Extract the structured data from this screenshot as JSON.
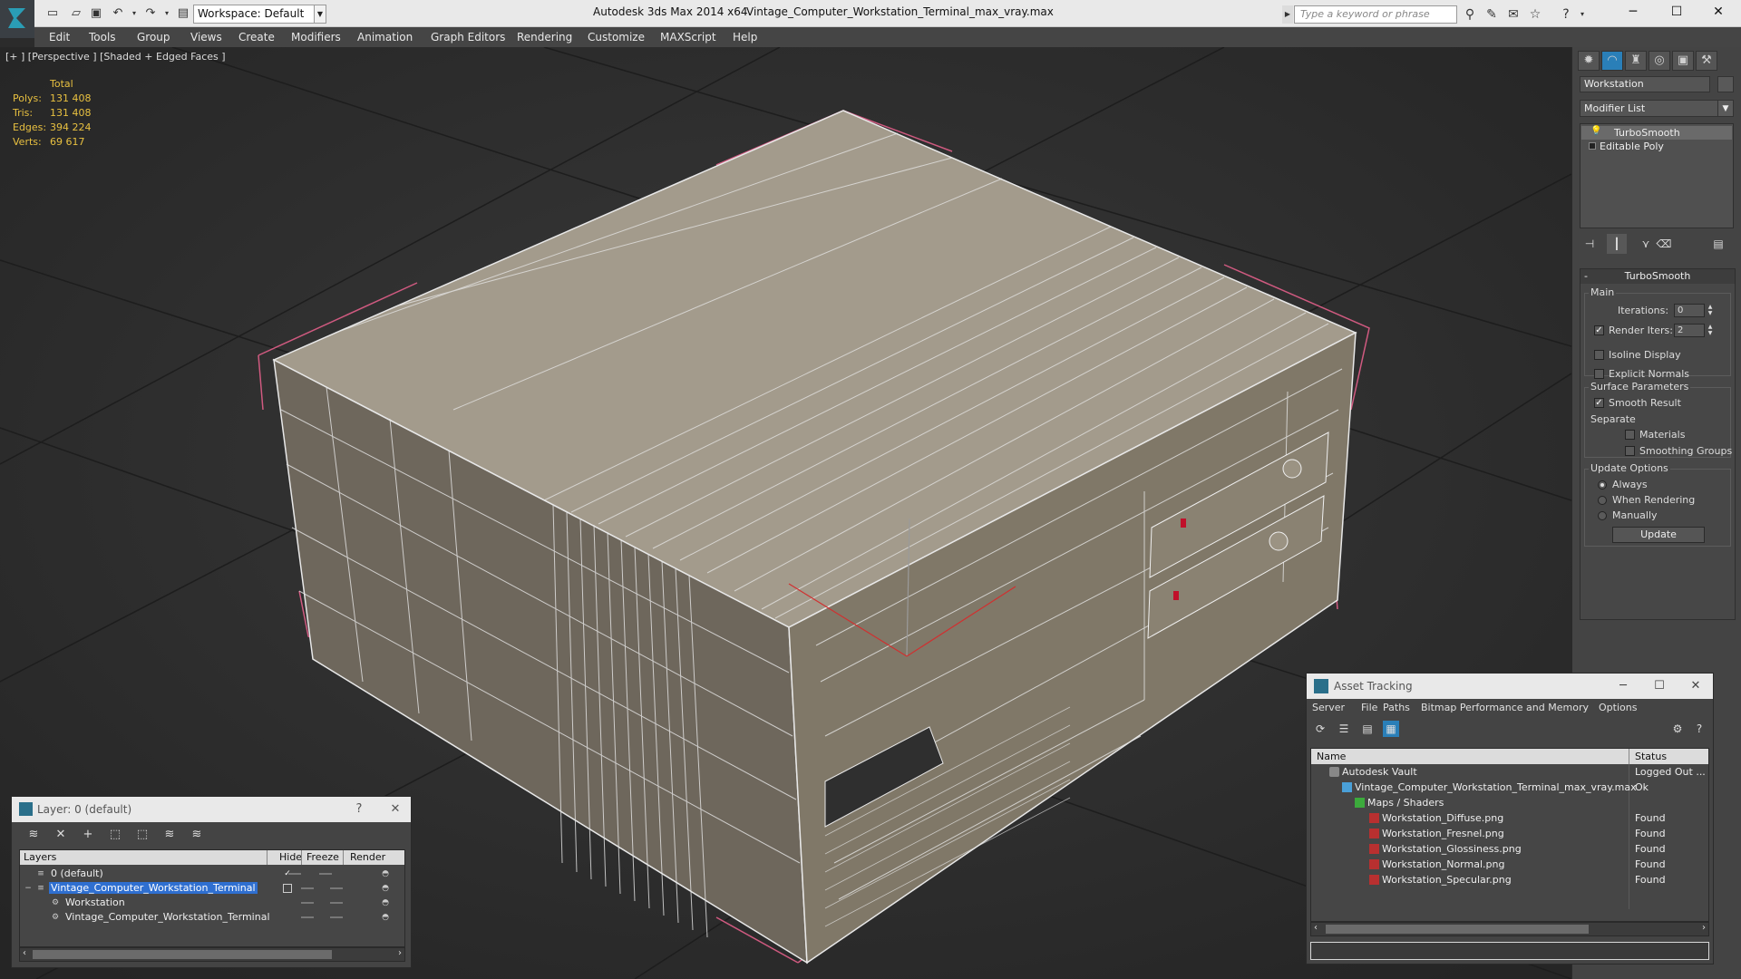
{
  "app": {
    "title_app": "Autodesk 3ds Max  2014 x64",
    "title_file": "Vintage_Computer_Workstation_Terminal_max_vray.max",
    "workspace": "Workspace: Default",
    "search_placeholder": "Type a keyword or phrase"
  },
  "menu": [
    "Edit",
    "Tools",
    "Group",
    "Views",
    "Create",
    "Modifiers",
    "Animation",
    "Graph Editors",
    "Rendering",
    "Customize",
    "MAXScript",
    "Help"
  ],
  "viewport": {
    "label": "[+ ] [Perspective ] [Shaded + Edged Faces ]",
    "stats": {
      "header": "Total",
      "rows": [
        {
          "k": "Polys:",
          "v": "131 408"
        },
        {
          "k": "Tris:",
          "v": "131 408"
        },
        {
          "k": "Edges:",
          "v": "394 224"
        },
        {
          "k": "Verts:",
          "v": "69 617"
        }
      ]
    }
  },
  "command_panel": {
    "object_name": "Workstation",
    "modifier_list": "Modifier List",
    "stack": [
      "TurboSmooth",
      "Editable Poly"
    ],
    "turbosmooth": {
      "title": "TurboSmooth",
      "main": "Main",
      "iterations_label": "Iterations:",
      "iterations": "0",
      "render_iters_label": "Render Iters:",
      "render_iters": "2",
      "isoline": "Isoline Display",
      "explicit": "Explicit Normals",
      "surface_params": "Surface Parameters",
      "smooth_result": "Smooth Result",
      "separate": "Separate",
      "materials": "Materials",
      "smoothing_groups": "Smoothing Groups",
      "update_options": "Update Options",
      "always": "Always",
      "when_rendering": "When Rendering",
      "manually": "Manually",
      "update_btn": "Update"
    }
  },
  "asset_tracking": {
    "title": "Asset Tracking",
    "menu": [
      "Server",
      "File",
      "Paths",
      "Bitmap Performance and Memory",
      "Options"
    ],
    "col_name": "Name",
    "col_status": "Status",
    "rows": [
      {
        "name": "Autodesk Vault",
        "status": "Logged Out ..."
      },
      {
        "name": "Vintage_Computer_Workstation_Terminal_max_vray.max",
        "status": "Ok"
      },
      {
        "name": "Maps / Shaders",
        "status": ""
      },
      {
        "name": "Workstation_Diffuse.png",
        "status": "Found"
      },
      {
        "name": "Workstation_Fresnel.png",
        "status": "Found"
      },
      {
        "name": "Workstation_Glossiness.png",
        "status": "Found"
      },
      {
        "name": "Workstation_Normal.png",
        "status": "Found"
      },
      {
        "name": "Workstation_Specular.png",
        "status": "Found"
      }
    ]
  },
  "layers": {
    "title": "Layer: 0 (default)",
    "help": "?",
    "col_layers": "Layers",
    "col_hide": "Hide",
    "col_freeze": "Freeze",
    "col_render": "Render",
    "rows": [
      {
        "name": "0 (default)"
      },
      {
        "name": "Vintage_Computer_Workstation_Terminal"
      },
      {
        "name": "Workstation"
      },
      {
        "name": "Vintage_Computer_Workstation_Terminal"
      }
    ]
  }
}
